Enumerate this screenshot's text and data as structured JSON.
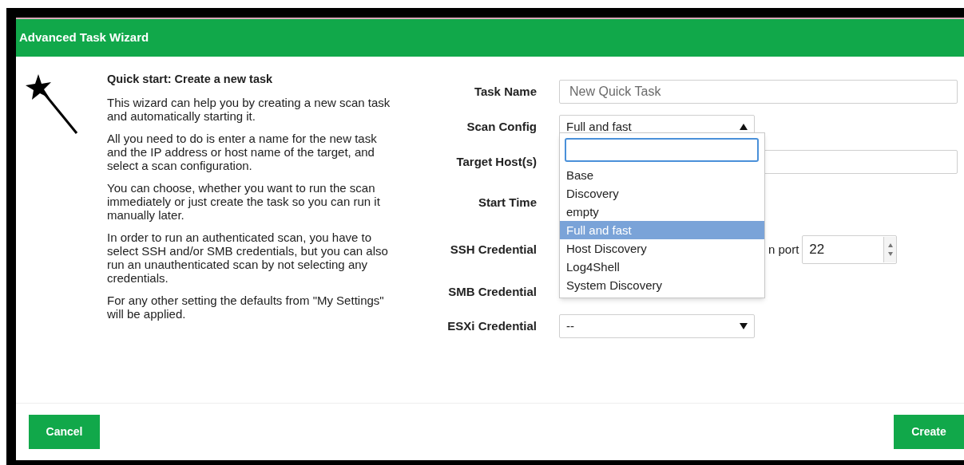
{
  "window": {
    "title": "Advanced Task Wizard"
  },
  "intro": {
    "heading": "Quick start: Create a new task",
    "paragraphs": [
      "This wizard can help you by creating a new scan task and automatically starting it.",
      "All you need to do is enter a name for the new task and the IP address or host name of the target, and select a scan configuration.",
      "You can choose, whether you want to run the scan immediately or just create the task so you can run it manually later.",
      "In order to run an authenticated scan, you have to select SSH and/or SMB credentials, but you can also run an unauthenticated scan by not selecting any credentials.",
      "For any other setting the defaults from \"My Settings\" will be applied."
    ]
  },
  "form": [
    {
      "kind": "text",
      "label": "Task Name",
      "placeholder": "New Quick Task"
    },
    {
      "kind": "select",
      "label": "Scan Config",
      "value": "Full and fast",
      "expanded": true
    },
    {
      "kind": "covered-text",
      "label": "Target Host(s)"
    },
    {
      "kind": "label-only",
      "label": "Start Time"
    },
    {
      "kind": "port",
      "label": "SSH Credential",
      "port_label": "n port",
      "port": "22"
    },
    {
      "kind": "label-only",
      "label": "SMB Credential"
    },
    {
      "kind": "select",
      "label": "ESXi Credential",
      "value": "--",
      "expanded": false
    }
  ],
  "dropdown": {
    "options": [
      {
        "label": "Base",
        "selected": false
      },
      {
        "label": "Discovery",
        "selected": false
      },
      {
        "label": "empty",
        "selected": false
      },
      {
        "label": "Full and fast",
        "selected": true
      },
      {
        "label": "Host Discovery",
        "selected": false
      },
      {
        "label": "Log4Shell",
        "selected": false
      },
      {
        "label": "System Discovery",
        "selected": false
      }
    ]
  },
  "buttons": [
    "Cancel",
    "Create"
  ]
}
